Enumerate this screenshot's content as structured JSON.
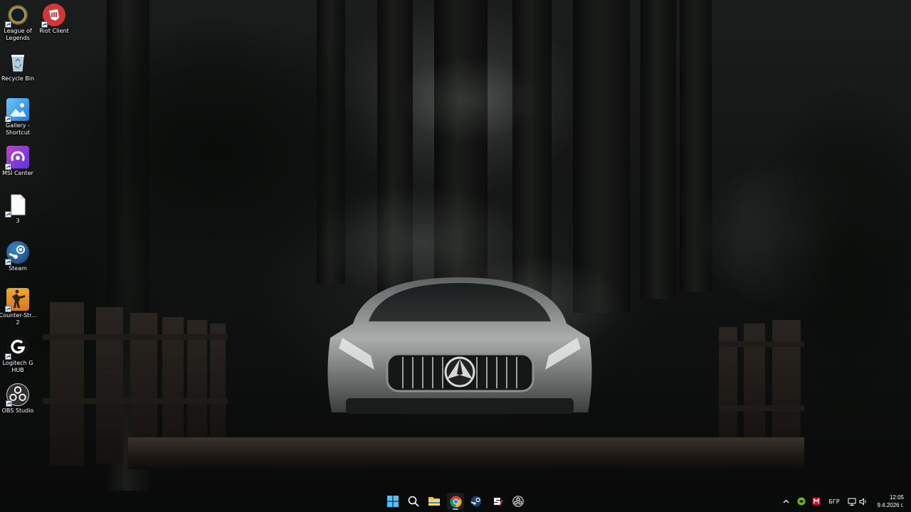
{
  "desktop": {
    "icons": [
      {
        "label": "League of Legends",
        "icon": "league-of-legends-icon"
      },
      {
        "label": "Riot Client",
        "icon": "riot-client-icon"
      },
      {
        "label": "Recycle Bin",
        "icon": "recycle-bin-icon"
      },
      {
        "label": "Gallery - Shortcut",
        "icon": "gallery-icon"
      },
      {
        "label": "MSI Center",
        "icon": "msi-center-icon"
      },
      {
        "label": "3",
        "icon": "file-icon"
      },
      {
        "label": "Steam",
        "icon": "steam-icon"
      },
      {
        "label": "Counter-Str... 2",
        "icon": "counter-strike-icon"
      },
      {
        "label": "Logitech G HUB",
        "icon": "logitech-g-hub-icon"
      },
      {
        "label": "OBS Studio",
        "icon": "obs-studio-icon"
      }
    ]
  },
  "taskbar": {
    "pinned": [
      "windows-start-icon",
      "search-icon",
      "file-explorer-icon",
      "chrome-icon",
      "steam-icon",
      "signalrgb-icon",
      "obs-studio-icon"
    ],
    "active_app": "chrome-icon",
    "tray": {
      "overflow_icon": "chevron-up-icon",
      "language": "БГР",
      "time": "12:05",
      "date": "9.4.2026 г."
    }
  },
  "colors": {
    "taskbar_bg": "#0a0b0b",
    "accent": "#7fb5ff",
    "riot_red": "#d13639",
    "msi_purple": "#8b3fd9"
  }
}
